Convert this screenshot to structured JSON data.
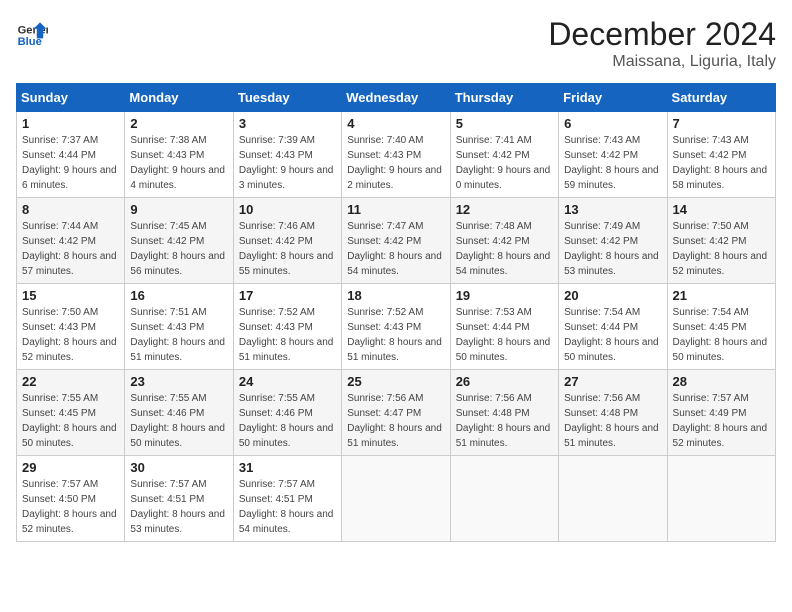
{
  "header": {
    "logo_line1": "General",
    "logo_line2": "Blue",
    "title": "December 2024",
    "subtitle": "Maissana, Liguria, Italy"
  },
  "weekdays": [
    "Sunday",
    "Monday",
    "Tuesday",
    "Wednesday",
    "Thursday",
    "Friday",
    "Saturday"
  ],
  "weeks": [
    [
      {
        "day": "1",
        "sunrise": "Sunrise: 7:37 AM",
        "sunset": "Sunset: 4:44 PM",
        "daylight": "Daylight: 9 hours and 6 minutes."
      },
      {
        "day": "2",
        "sunrise": "Sunrise: 7:38 AM",
        "sunset": "Sunset: 4:43 PM",
        "daylight": "Daylight: 9 hours and 4 minutes."
      },
      {
        "day": "3",
        "sunrise": "Sunrise: 7:39 AM",
        "sunset": "Sunset: 4:43 PM",
        "daylight": "Daylight: 9 hours and 3 minutes."
      },
      {
        "day": "4",
        "sunrise": "Sunrise: 7:40 AM",
        "sunset": "Sunset: 4:43 PM",
        "daylight": "Daylight: 9 hours and 2 minutes."
      },
      {
        "day": "5",
        "sunrise": "Sunrise: 7:41 AM",
        "sunset": "Sunset: 4:42 PM",
        "daylight": "Daylight: 9 hours and 0 minutes."
      },
      {
        "day": "6",
        "sunrise": "Sunrise: 7:43 AM",
        "sunset": "Sunset: 4:42 PM",
        "daylight": "Daylight: 8 hours and 59 minutes."
      },
      {
        "day": "7",
        "sunrise": "Sunrise: 7:43 AM",
        "sunset": "Sunset: 4:42 PM",
        "daylight": "Daylight: 8 hours and 58 minutes."
      }
    ],
    [
      {
        "day": "8",
        "sunrise": "Sunrise: 7:44 AM",
        "sunset": "Sunset: 4:42 PM",
        "daylight": "Daylight: 8 hours and 57 minutes."
      },
      {
        "day": "9",
        "sunrise": "Sunrise: 7:45 AM",
        "sunset": "Sunset: 4:42 PM",
        "daylight": "Daylight: 8 hours and 56 minutes."
      },
      {
        "day": "10",
        "sunrise": "Sunrise: 7:46 AM",
        "sunset": "Sunset: 4:42 PM",
        "daylight": "Daylight: 8 hours and 55 minutes."
      },
      {
        "day": "11",
        "sunrise": "Sunrise: 7:47 AM",
        "sunset": "Sunset: 4:42 PM",
        "daylight": "Daylight: 8 hours and 54 minutes."
      },
      {
        "day": "12",
        "sunrise": "Sunrise: 7:48 AM",
        "sunset": "Sunset: 4:42 PM",
        "daylight": "Daylight: 8 hours and 54 minutes."
      },
      {
        "day": "13",
        "sunrise": "Sunrise: 7:49 AM",
        "sunset": "Sunset: 4:42 PM",
        "daylight": "Daylight: 8 hours and 53 minutes."
      },
      {
        "day": "14",
        "sunrise": "Sunrise: 7:50 AM",
        "sunset": "Sunset: 4:42 PM",
        "daylight": "Daylight: 8 hours and 52 minutes."
      }
    ],
    [
      {
        "day": "15",
        "sunrise": "Sunrise: 7:50 AM",
        "sunset": "Sunset: 4:43 PM",
        "daylight": "Daylight: 8 hours and 52 minutes."
      },
      {
        "day": "16",
        "sunrise": "Sunrise: 7:51 AM",
        "sunset": "Sunset: 4:43 PM",
        "daylight": "Daylight: 8 hours and 51 minutes."
      },
      {
        "day": "17",
        "sunrise": "Sunrise: 7:52 AM",
        "sunset": "Sunset: 4:43 PM",
        "daylight": "Daylight: 8 hours and 51 minutes."
      },
      {
        "day": "18",
        "sunrise": "Sunrise: 7:52 AM",
        "sunset": "Sunset: 4:43 PM",
        "daylight": "Daylight: 8 hours and 51 minutes."
      },
      {
        "day": "19",
        "sunrise": "Sunrise: 7:53 AM",
        "sunset": "Sunset: 4:44 PM",
        "daylight": "Daylight: 8 hours and 50 minutes."
      },
      {
        "day": "20",
        "sunrise": "Sunrise: 7:54 AM",
        "sunset": "Sunset: 4:44 PM",
        "daylight": "Daylight: 8 hours and 50 minutes."
      },
      {
        "day": "21",
        "sunrise": "Sunrise: 7:54 AM",
        "sunset": "Sunset: 4:45 PM",
        "daylight": "Daylight: 8 hours and 50 minutes."
      }
    ],
    [
      {
        "day": "22",
        "sunrise": "Sunrise: 7:55 AM",
        "sunset": "Sunset: 4:45 PM",
        "daylight": "Daylight: 8 hours and 50 minutes."
      },
      {
        "day": "23",
        "sunrise": "Sunrise: 7:55 AM",
        "sunset": "Sunset: 4:46 PM",
        "daylight": "Daylight: 8 hours and 50 minutes."
      },
      {
        "day": "24",
        "sunrise": "Sunrise: 7:55 AM",
        "sunset": "Sunset: 4:46 PM",
        "daylight": "Daylight: 8 hours and 50 minutes."
      },
      {
        "day": "25",
        "sunrise": "Sunrise: 7:56 AM",
        "sunset": "Sunset: 4:47 PM",
        "daylight": "Daylight: 8 hours and 51 minutes."
      },
      {
        "day": "26",
        "sunrise": "Sunrise: 7:56 AM",
        "sunset": "Sunset: 4:48 PM",
        "daylight": "Daylight: 8 hours and 51 minutes."
      },
      {
        "day": "27",
        "sunrise": "Sunrise: 7:56 AM",
        "sunset": "Sunset: 4:48 PM",
        "daylight": "Daylight: 8 hours and 51 minutes."
      },
      {
        "day": "28",
        "sunrise": "Sunrise: 7:57 AM",
        "sunset": "Sunset: 4:49 PM",
        "daylight": "Daylight: 8 hours and 52 minutes."
      }
    ],
    [
      {
        "day": "29",
        "sunrise": "Sunrise: 7:57 AM",
        "sunset": "Sunset: 4:50 PM",
        "daylight": "Daylight: 8 hours and 52 minutes."
      },
      {
        "day": "30",
        "sunrise": "Sunrise: 7:57 AM",
        "sunset": "Sunset: 4:51 PM",
        "daylight": "Daylight: 8 hours and 53 minutes."
      },
      {
        "day": "31",
        "sunrise": "Sunrise: 7:57 AM",
        "sunset": "Sunset: 4:51 PM",
        "daylight": "Daylight: 8 hours and 54 minutes."
      },
      null,
      null,
      null,
      null
    ]
  ]
}
